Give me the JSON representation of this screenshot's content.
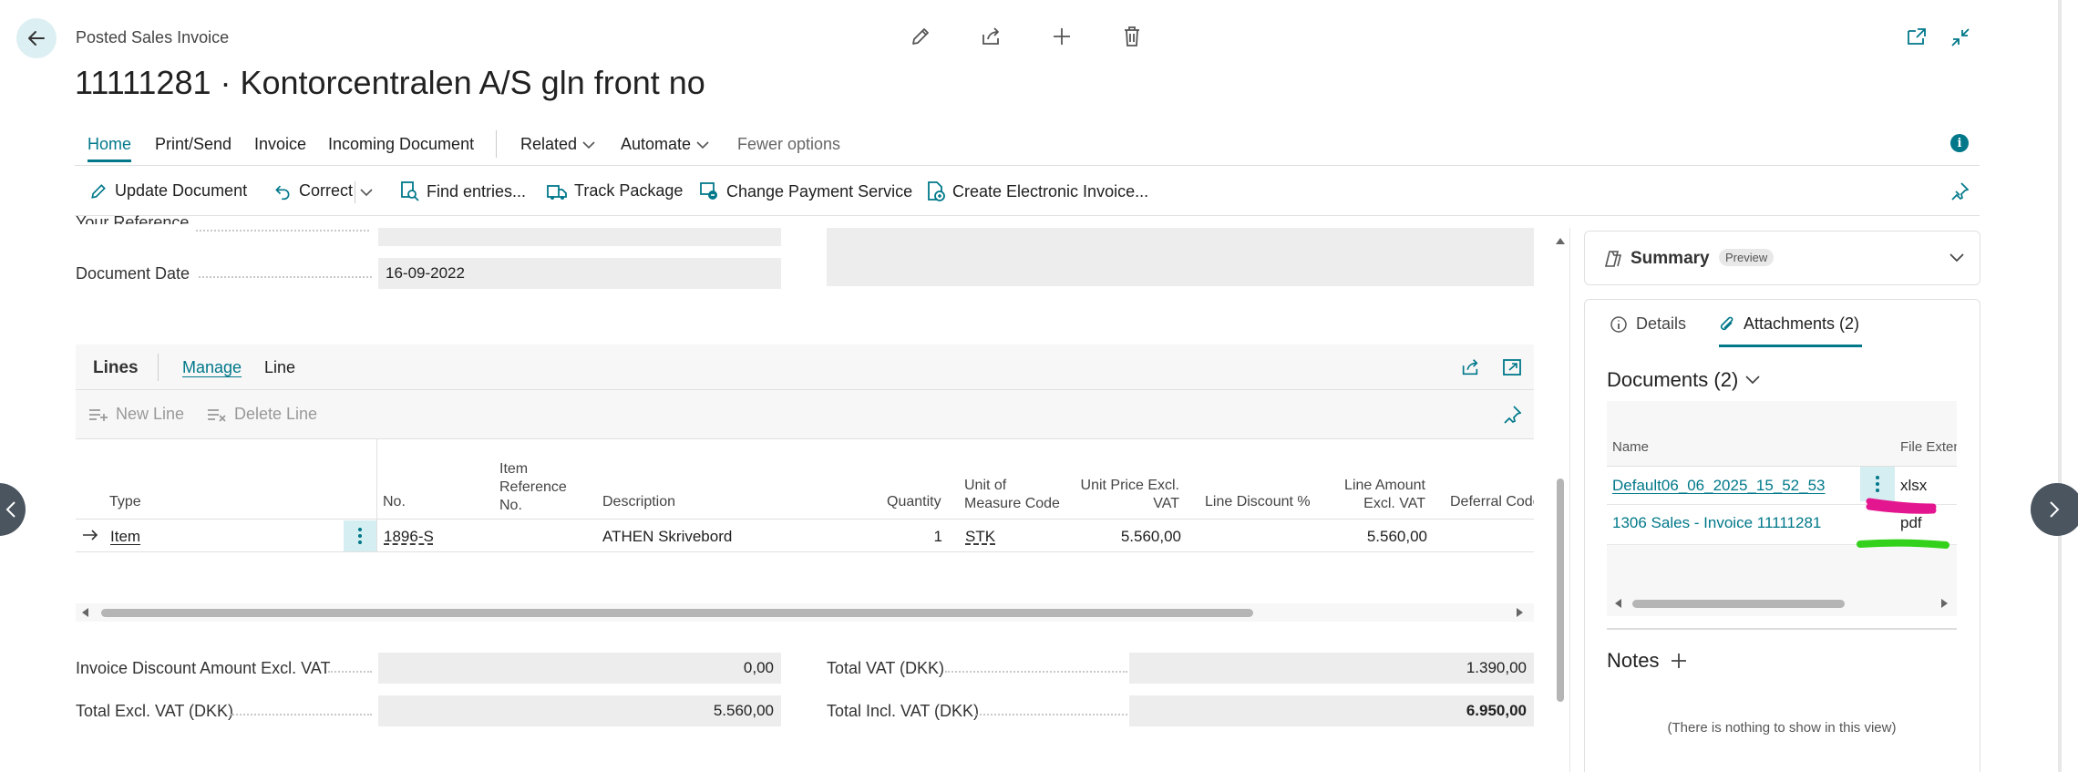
{
  "header": {
    "page_type": "Posted Sales Invoice",
    "title": "11111281 · Kontorcentralen A/S gln front no"
  },
  "nav": {
    "tabs": [
      "Home",
      "Print/Send",
      "Invoice",
      "Incoming Document"
    ],
    "related": "Related",
    "automate": "Automate",
    "fewer": "Fewer options"
  },
  "actions": {
    "update": "Update Document",
    "correct": "Correct",
    "find": "Find entries...",
    "track": "Track Package",
    "payment": "Change Payment Service",
    "electronic": "Create Electronic Invoice..."
  },
  "fields": {
    "your_reference_label": "Your Reference",
    "your_reference_value": "",
    "document_date_label": "Document Date",
    "document_date_value": "16-09-2022"
  },
  "lines": {
    "title": "Lines",
    "tab_manage": "Manage",
    "tab_line": "Line",
    "new_line": "New Line",
    "delete_line": "Delete Line",
    "columns": {
      "type": "Type",
      "no": "No.",
      "item_ref_1": "Item",
      "item_ref_2": "Reference",
      "item_ref_3": "No.",
      "description": "Description",
      "quantity": "Quantity",
      "uom_1": "Unit of",
      "uom_2": "Measure Code",
      "unit_price_1": "Unit Price Excl.",
      "unit_price_2": "VAT",
      "line_discount": "Line Discount %",
      "line_amount_1": "Line Amount",
      "line_amount_2": "Excl. VAT",
      "deferral": "Deferral Code"
    },
    "row": {
      "type": "Item",
      "no": "1896-S",
      "description": "ATHEN Skrivebord",
      "quantity": "1",
      "uom": "STK",
      "unit_price": "5.560,00",
      "line_amount": "5.560,00"
    }
  },
  "totals": {
    "inv_discount_label": "Invoice Discount Amount Excl. VAT",
    "inv_discount_value": "0,00",
    "total_excl_label": "Total Excl. VAT (DKK)",
    "total_excl_value": "5.560,00",
    "total_vat_label": "Total VAT (DKK)",
    "total_vat_value": "1.390,00",
    "total_incl_label": "Total Incl. VAT (DKK)",
    "total_incl_value": "6.950,00"
  },
  "factbox": {
    "summary": "Summary",
    "preview_badge": "Preview",
    "tab_details": "Details",
    "tab_attachments": "Attachments (2)",
    "documents_title": "Documents (2)",
    "col_name": "Name",
    "col_ext": "File Exten",
    "docs": [
      {
        "name": "Default06_06_2025_15_52_53",
        "ext": "xlsx"
      },
      {
        "name": "1306 Sales - Invoice 11111281",
        "ext": "pdf"
      }
    ],
    "notes_title": "Notes",
    "notes_empty": "(There is nothing to show in this view)"
  },
  "colors": {
    "accent": "#00788a",
    "magenta_mark": "#e3168f",
    "green_mark": "#34d11c",
    "field_bg": "#ededed"
  }
}
